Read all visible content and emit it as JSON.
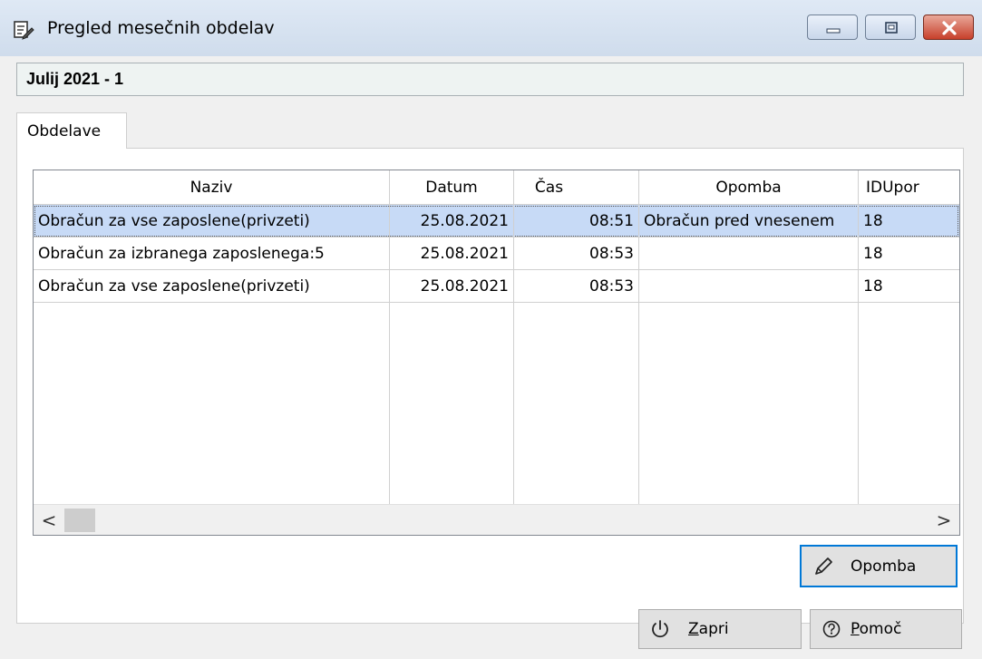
{
  "window": {
    "title": "Pregled mesečnih obdelav"
  },
  "header": {
    "period": "Julij 2021 - 1"
  },
  "tabs": [
    {
      "label": "Obdelave",
      "active": true
    }
  ],
  "table": {
    "columns": [
      "Naziv",
      "Datum",
      "Čas",
      "Opomba",
      "IDUpor"
    ],
    "rows": [
      {
        "naziv": "Obračun za vse zaposlene(privzeti)",
        "datum": "25.08.2021",
        "cas": "08:51",
        "opomba": "Obračun pred vnesenem",
        "idupor": "18",
        "selected": true
      },
      {
        "naziv": "Obračun za izbranega zaposlenega:5",
        "datum": "25.08.2021",
        "cas": "08:53",
        "opomba": "",
        "idupor": "18",
        "selected": false
      },
      {
        "naziv": "Obračun za vse zaposlene(privzeti)",
        "datum": "25.08.2021",
        "cas": "08:53",
        "opomba": "",
        "idupor": "18",
        "selected": false
      }
    ]
  },
  "buttons": {
    "opomba": {
      "label": "Opomba",
      "icon": "pencil-icon"
    },
    "zapri": {
      "mnemonic": "Z",
      "rest": "apri",
      "icon": "power-icon"
    },
    "pomoc": {
      "mnemonic": "P",
      "rest": "omoč",
      "icon": "help-icon"
    }
  },
  "scrollbar": {
    "left_arrow": "<",
    "right_arrow": ">"
  },
  "colors": {
    "selection": "#c7daf6",
    "focus_border": "#0078d7",
    "close_button": "#c7402b"
  }
}
